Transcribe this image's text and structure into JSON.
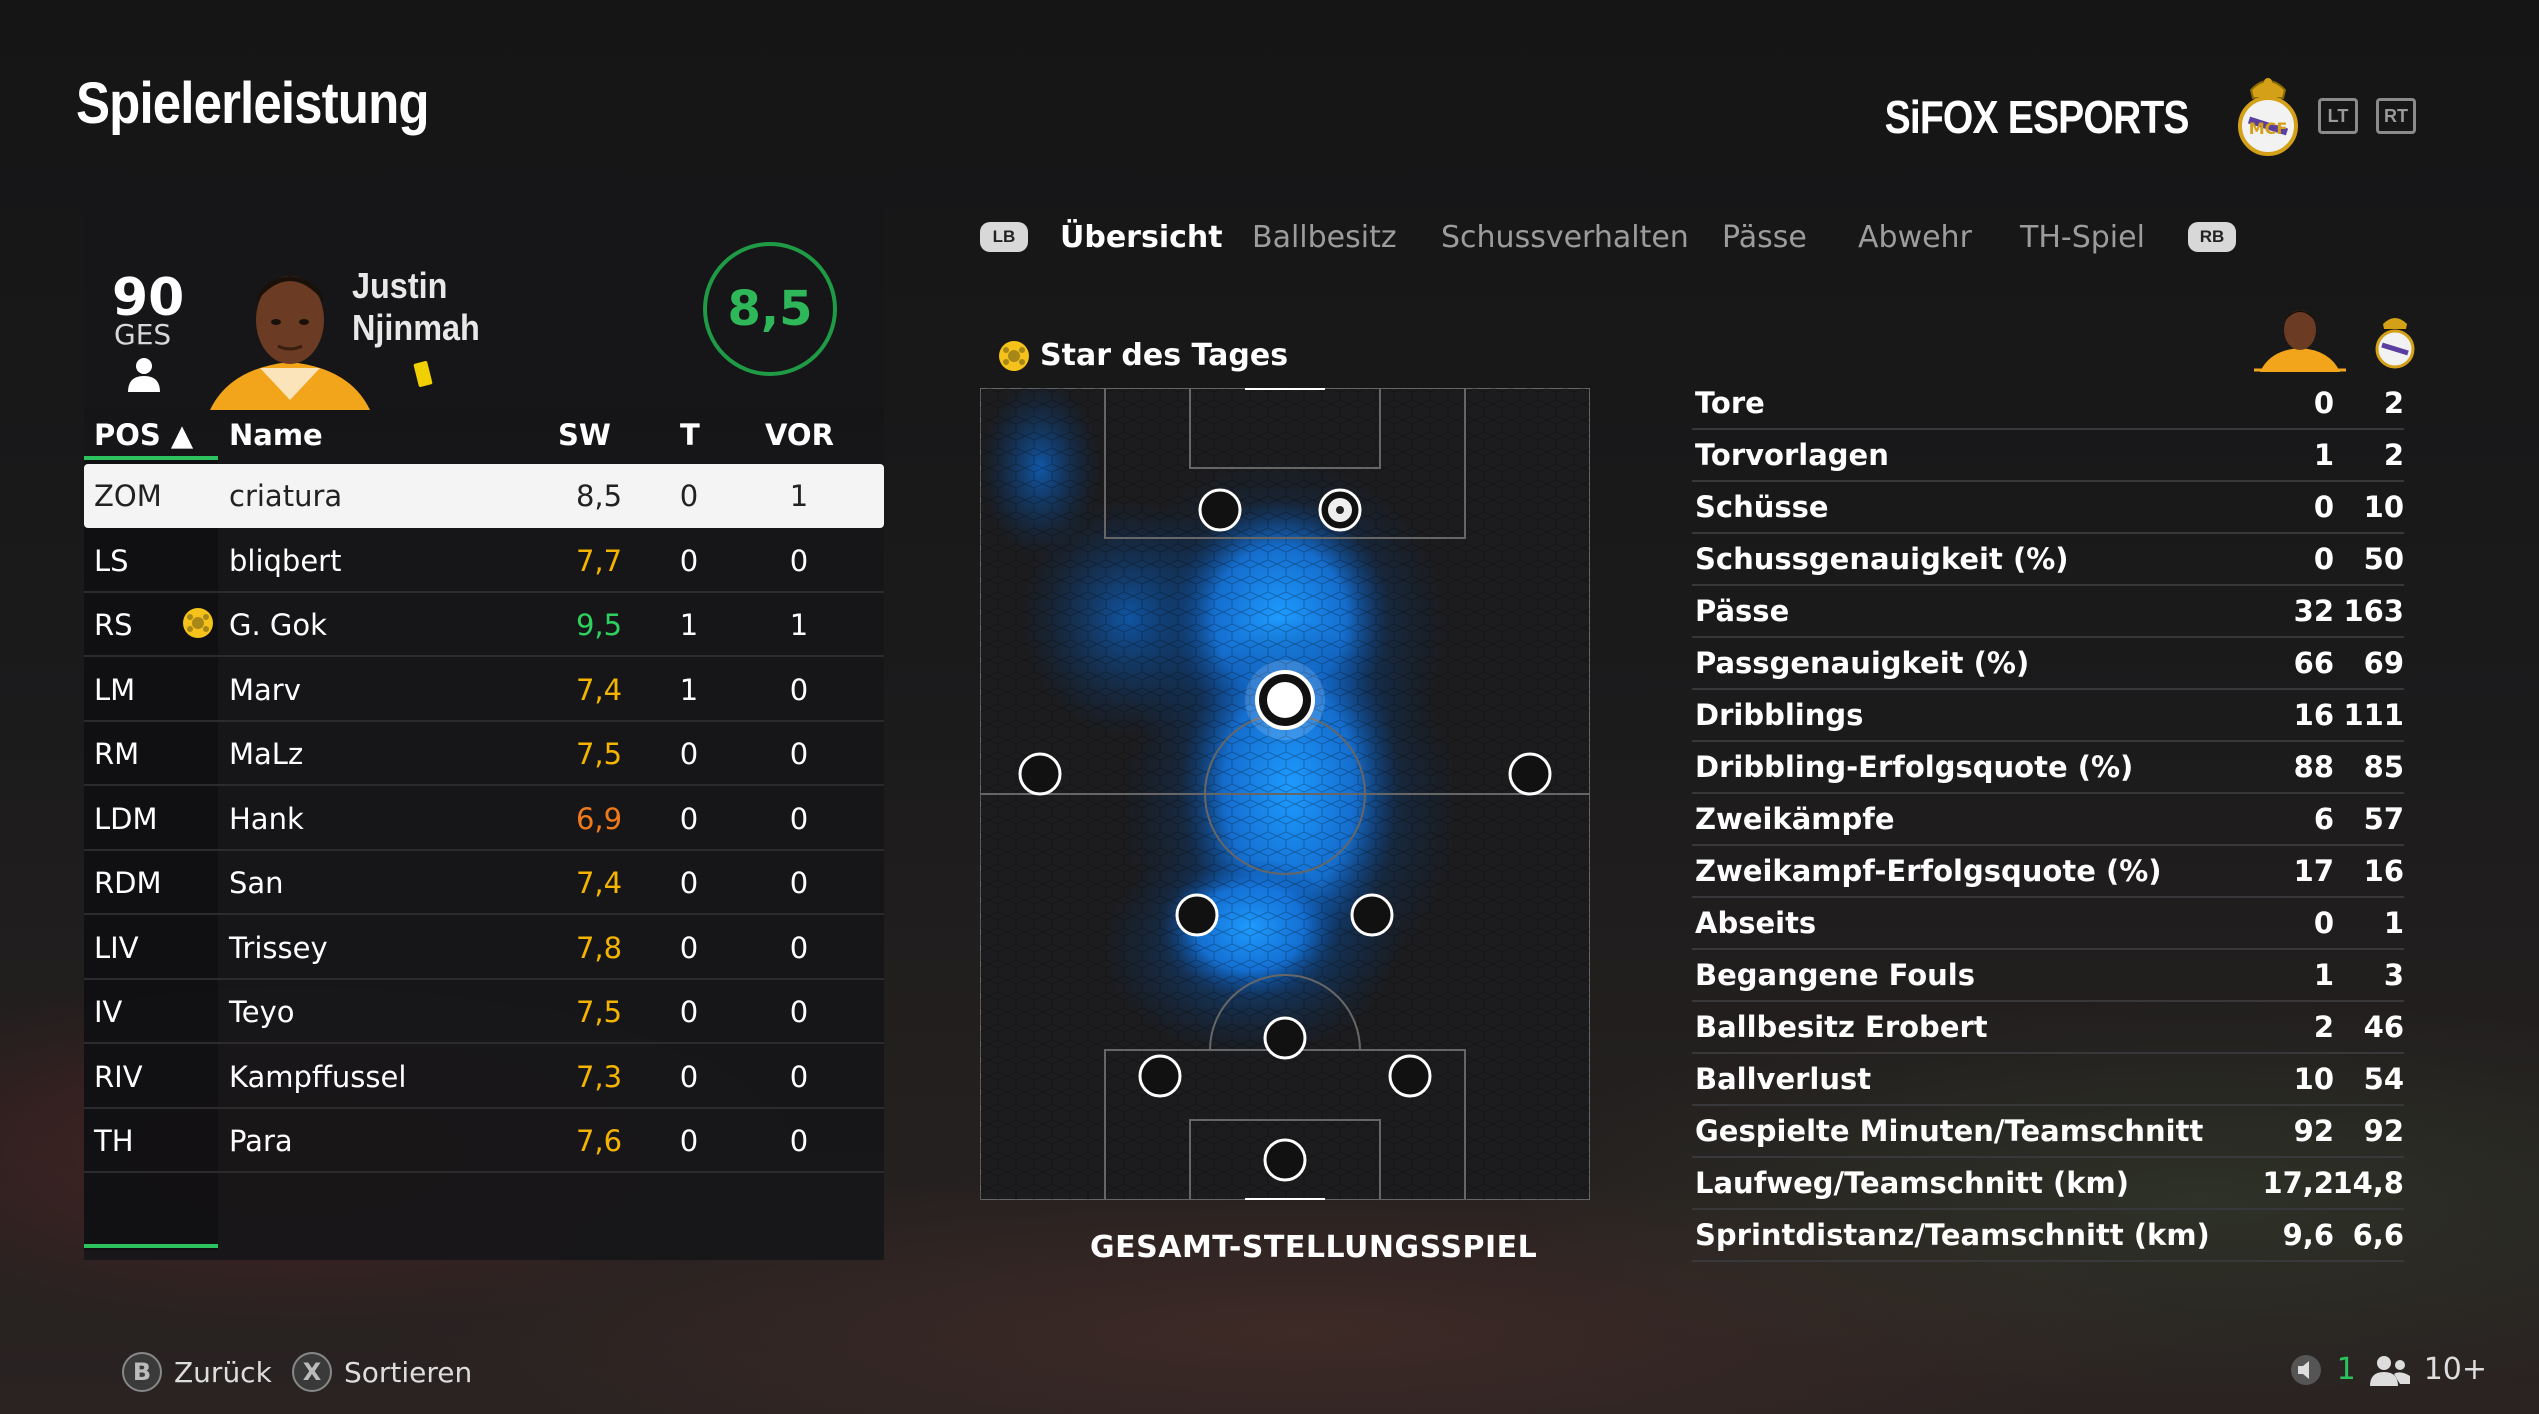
{
  "header": {
    "title": "Spielerleistung",
    "club_name": "SiFOX ESPORTS",
    "lt_label": "LT",
    "rt_label": "RT"
  },
  "player_card": {
    "overall": "90",
    "overall_label": "GES",
    "first_name": "Justin",
    "last_name": "Njinmah",
    "rating": "8,5"
  },
  "table": {
    "headers": {
      "pos": "POS ▲",
      "name": "Name",
      "sw": "SW",
      "t": "T",
      "vor": "VOR"
    },
    "rows": [
      {
        "pos": "ZOM",
        "name": "criatura",
        "sw": "8,5",
        "t": "0",
        "vor": "1",
        "sw_color": "#222222",
        "selected": true
      },
      {
        "pos": "LS",
        "name": "bliqbert",
        "sw": "7,7",
        "t": "0",
        "vor": "0",
        "sw_color": "#f4b400"
      },
      {
        "pos": "RS",
        "name": "G. Gok",
        "sw": "9,5",
        "t": "1",
        "vor": "1",
        "sw_color": "#2ed15e",
        "star": true
      },
      {
        "pos": "LM",
        "name": "Marv",
        "sw": "7,4",
        "t": "1",
        "vor": "0",
        "sw_color": "#f4b400"
      },
      {
        "pos": "RM",
        "name": "MaLz",
        "sw": "7,5",
        "t": "0",
        "vor": "0",
        "sw_color": "#f4b400"
      },
      {
        "pos": "LDM",
        "name": "Hank",
        "sw": "6,9",
        "t": "0",
        "vor": "0",
        "sw_color": "#f07a1a"
      },
      {
        "pos": "RDM",
        "name": "San",
        "sw": "7,4",
        "t": "0",
        "vor": "0",
        "sw_color": "#f4b400"
      },
      {
        "pos": "LIV",
        "name": "Trissey",
        "sw": "7,8",
        "t": "0",
        "vor": "0",
        "sw_color": "#f4b400"
      },
      {
        "pos": "IV",
        "name": "Teyo",
        "sw": "7,5",
        "t": "0",
        "vor": "0",
        "sw_color": "#f4b400"
      },
      {
        "pos": "RIV",
        "name": "Kampffussel",
        "sw": "7,3",
        "t": "0",
        "vor": "0",
        "sw_color": "#f4b400"
      },
      {
        "pos": "TH",
        "name": "Para",
        "sw": "7,6",
        "t": "0",
        "vor": "0",
        "sw_color": "#f4b400"
      }
    ]
  },
  "tabs": {
    "lb": "LB",
    "rb": "RB",
    "items": [
      "Übersicht",
      "Ballbesitz",
      "Schussverhalten",
      "Pässe",
      "Abwehr",
      "TH-Spiel"
    ],
    "active": "Übersicht"
  },
  "pitch": {
    "star_label": "Star des Tages",
    "caption": "GESAMT-STELLUNGSSPIEL"
  },
  "stats": [
    {
      "label": "Tore",
      "player": "0",
      "team": "2"
    },
    {
      "label": "Torvorlagen",
      "player": "1",
      "team": "2"
    },
    {
      "label": "Schüsse",
      "player": "0",
      "team": "10"
    },
    {
      "label": "Schussgenauigkeit (%)",
      "player": "0",
      "team": "50"
    },
    {
      "label": "Pässe",
      "player": "32",
      "team": "163"
    },
    {
      "label": "Passgenauigkeit (%)",
      "player": "66",
      "team": "69"
    },
    {
      "label": "Dribblings",
      "player": "16",
      "team": "111"
    },
    {
      "label": "Dribbling-Erfolgsquote (%)",
      "player": "88",
      "team": "85"
    },
    {
      "label": "Zweikämpfe",
      "player": "6",
      "team": "57"
    },
    {
      "label": "Zweikampf-Erfolgsquote (%)",
      "player": "17",
      "team": "16"
    },
    {
      "label": "Abseits",
      "player": "0",
      "team": "1"
    },
    {
      "label": "Begangene Fouls",
      "player": "1",
      "team": "3"
    },
    {
      "label": "Ballbesitz Erobert",
      "player": "2",
      "team": "46"
    },
    {
      "label": "Ballverlust",
      "player": "10",
      "team": "54"
    },
    {
      "label": "Gespielte Minuten/Teamschnitt",
      "player": "92",
      "team": "92"
    },
    {
      "label": "Laufweg/Teamschnitt (km)",
      "player": "17,2",
      "team": "14,8"
    },
    {
      "label": "Sprintdistanz/Teamschnitt (km)",
      "player": "9,6",
      "team": "6,6"
    }
  ],
  "footer": {
    "back_btn": "B",
    "back_label": "Zurück",
    "sort_btn": "X",
    "sort_label": "Sortieren",
    "count_a": "1",
    "count_b": "10+"
  },
  "colors": {
    "accent_green": "#2cc25d",
    "heatmap_blue": "#1e88ff"
  }
}
